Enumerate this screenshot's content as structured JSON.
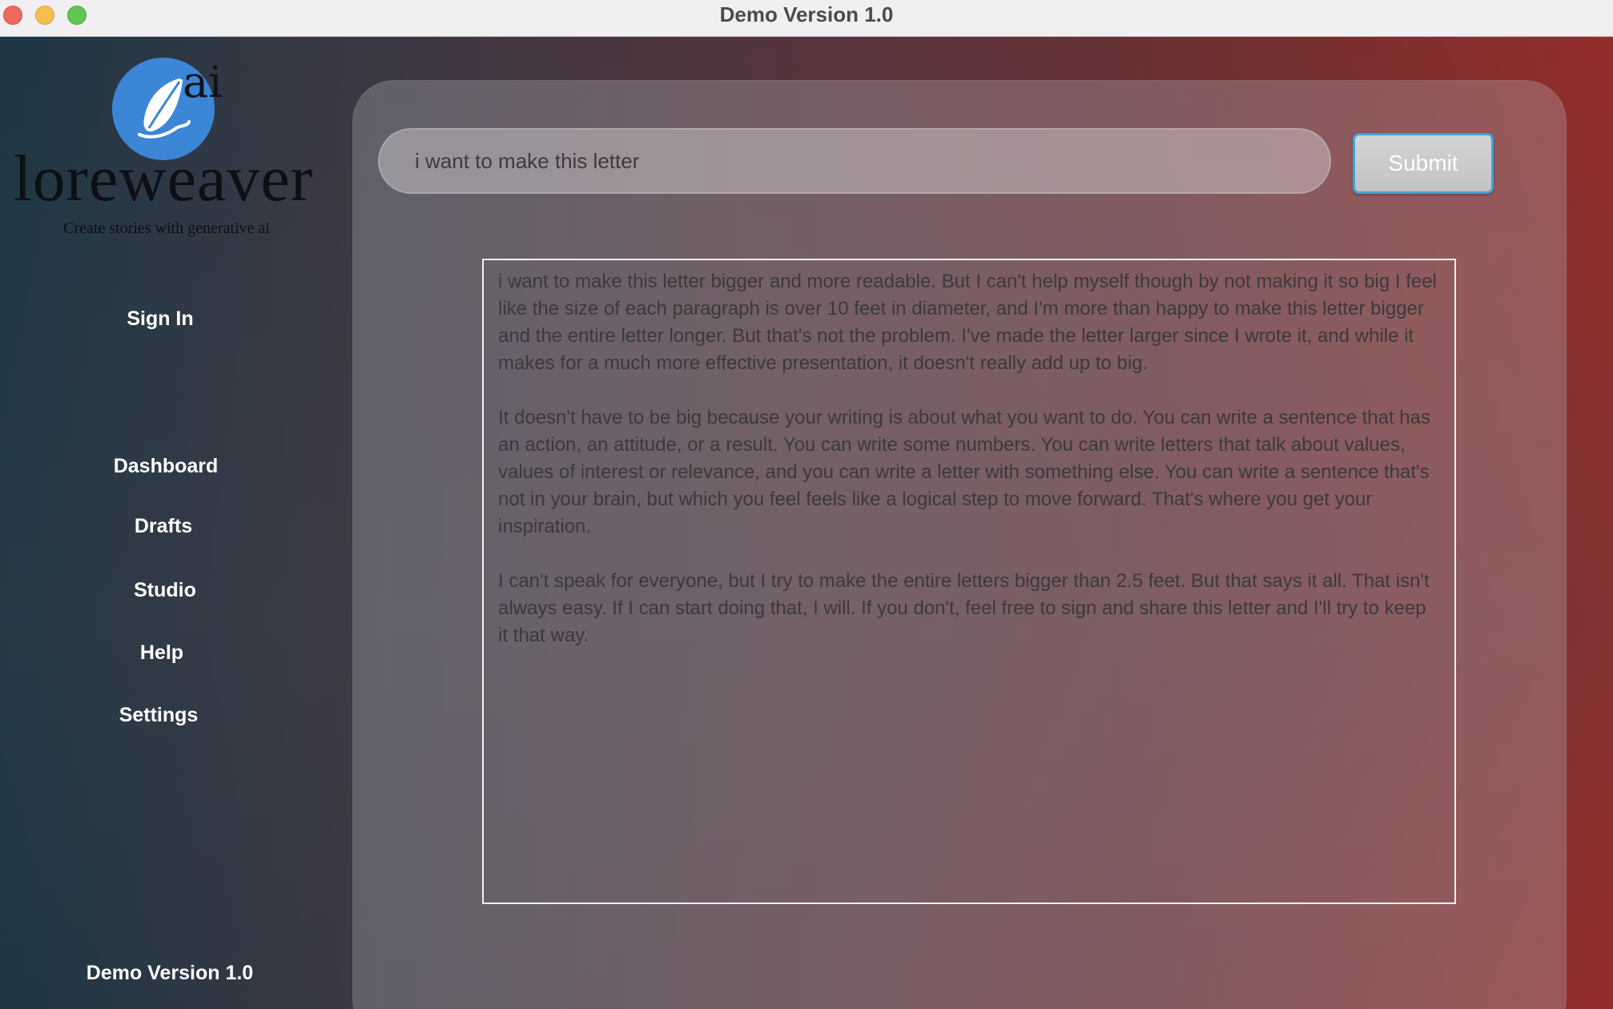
{
  "window": {
    "title": "Demo Version 1.0"
  },
  "logo": {
    "badge": "ai",
    "name": "loreweaver",
    "tagline": "Create stories with generative ai",
    "icon": "feather-icon",
    "accent_color": "#3c86d8"
  },
  "sidebar": {
    "sign_in": "Sign In",
    "items": [
      {
        "label": "Dashboard"
      },
      {
        "label": "Drafts"
      },
      {
        "label": "Studio"
      },
      {
        "label": "Help"
      },
      {
        "label": "Settings"
      }
    ],
    "footer": "Demo Version 1.0"
  },
  "prompt": {
    "value": "i want to make this letter",
    "submit_label": "Submit"
  },
  "output": {
    "paragraphs": [
      "i want to make this letter bigger and more readable. But I can't help myself though by not making it so big I feel like the size of each paragraph is over 10 feet in diameter, and I'm more than happy to make this letter bigger and the entire letter longer. But that's not the problem. I've made the letter larger since I wrote it, and while it makes for a much more effective presentation, it doesn't really add up to big.",
      "It doesn't have to be big because your writing is about what you want to do. You can write a sentence that has an action, an attitude, or a result. You can write some numbers. You can write letters that talk about values, values of interest or relevance, and you can write a letter with something else. You can write a sentence that's not in your brain, but which you feel feels like a logical step to move forward. That's where you get your inspiration.",
      "I can't speak for everyone, but I try to make the entire letters bigger than 2.5 feet. But that says it all. That isn't always easy. If I can start doing that, I will. If you don't, feel free to sign and share this letter and I'll try to keep it that way."
    ]
  },
  "colors": {
    "submit_border": "#3aa6d6",
    "gradient_left": "#1f3947",
    "gradient_right": "#9a2f2c"
  }
}
